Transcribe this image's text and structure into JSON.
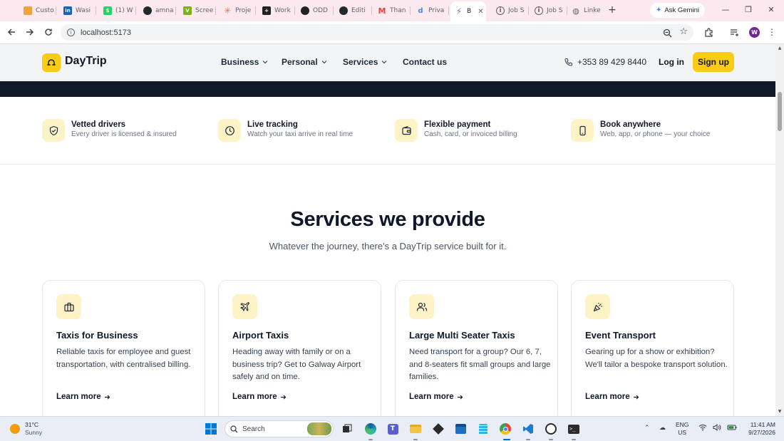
{
  "browser": {
    "tabs": [
      {
        "label": "Custo",
        "icon": "custom-tab-icon",
        "color": "#f0a33a"
      },
      {
        "label": "Wasi",
        "icon": "linkedin-icon",
        "color": "#0a66c2"
      },
      {
        "label": "(1) W",
        "icon": "whatsapp-icon",
        "color": "#25d366"
      },
      {
        "label": "amna",
        "icon": "github-icon",
        "color": "#24292f"
      },
      {
        "label": "Scree",
        "icon": "screen-icon",
        "color": "#7ab317"
      },
      {
        "label": "Proje",
        "icon": "asterisk-icon",
        "color": "#d97757"
      },
      {
        "label": "Work",
        "icon": "workflow-icon",
        "color": "#202124"
      },
      {
        "label": "ODD",
        "icon": "odd-icon",
        "color": "#202124"
      },
      {
        "label": "Editi",
        "icon": "github-icon",
        "color": "#24292f"
      },
      {
        "label": "Than",
        "icon": "gmail-icon",
        "color": "#ea4335"
      },
      {
        "label": "Priva",
        "icon": "d-icon",
        "color": "#4285f4"
      },
      {
        "label": "B",
        "icon": "vite-icon",
        "color": "#8b5cf6",
        "active": true
      },
      {
        "label": "Job S",
        "icon": "info-icon",
        "color": "#5f6368"
      },
      {
        "label": "Job S",
        "icon": "info-icon",
        "color": "#5f6368"
      },
      {
        "label": "Linke",
        "icon": "globe-icon",
        "color": "#5f6368"
      }
    ],
    "gemini_label": "Ask Gemini",
    "url": "localhost:5173",
    "profile_initial": "W"
  },
  "site": {
    "brand": "DayTrip",
    "nav": [
      {
        "label": "Business",
        "dropdown": true
      },
      {
        "label": "Personal",
        "dropdown": true
      },
      {
        "label": "Services",
        "dropdown": true
      },
      {
        "label": "Contact us",
        "dropdown": false
      }
    ],
    "phone": "+353 89 429 8440",
    "login": "Log in",
    "signup": "Sign up",
    "features": [
      {
        "title": "Vetted drivers",
        "subtitle": "Every driver is licensed & insured",
        "icon": "shield-check-icon"
      },
      {
        "title": "Live tracking",
        "subtitle": "Watch your taxi arrive in real time",
        "icon": "clock-icon"
      },
      {
        "title": "Flexible payment",
        "subtitle": "Cash, card, or invoiced billing",
        "icon": "wallet-icon"
      },
      {
        "title": "Book anywhere",
        "subtitle": "Web, app, or phone — your choice",
        "icon": "smartphone-icon"
      }
    ],
    "services": {
      "heading": "Services we provide",
      "subheading": "Whatever the journey, there's a DayTrip service built for it.",
      "cards": [
        {
          "title": "Taxis for Business",
          "description": "Reliable taxis for employee and guest transportation, with centralised billing.",
          "link": "Learn more",
          "icon": "briefcase-icon"
        },
        {
          "title": "Airport Taxis",
          "description": "Heading away with family or on a business trip? Get to Galway Airport safely and on time.",
          "link": "Learn more",
          "icon": "plane-icon"
        },
        {
          "title": "Large Multi Seater Taxis",
          "description": "Need transport for a group? Our 6, 7, and 8-seaters fit small groups and large families.",
          "link": "Learn more",
          "icon": "users-icon"
        },
        {
          "title": "Event Transport",
          "description": "Gearing up for a show or exhibition? We'll tailor a bespoke transport solution.",
          "link": "Learn more",
          "icon": "party-popper-icon"
        }
      ]
    }
  },
  "taskbar": {
    "weather_temp": "31°C",
    "weather_desc": "Sunny",
    "search_label": "Search",
    "lang_line1": "ENG",
    "lang_line2": "US",
    "time": "11:41 AM",
    "date": "9/27/2026"
  },
  "colors": {
    "accent": "#facc15",
    "accent_soft": "#fef3c7",
    "dark_band": "#111827"
  }
}
